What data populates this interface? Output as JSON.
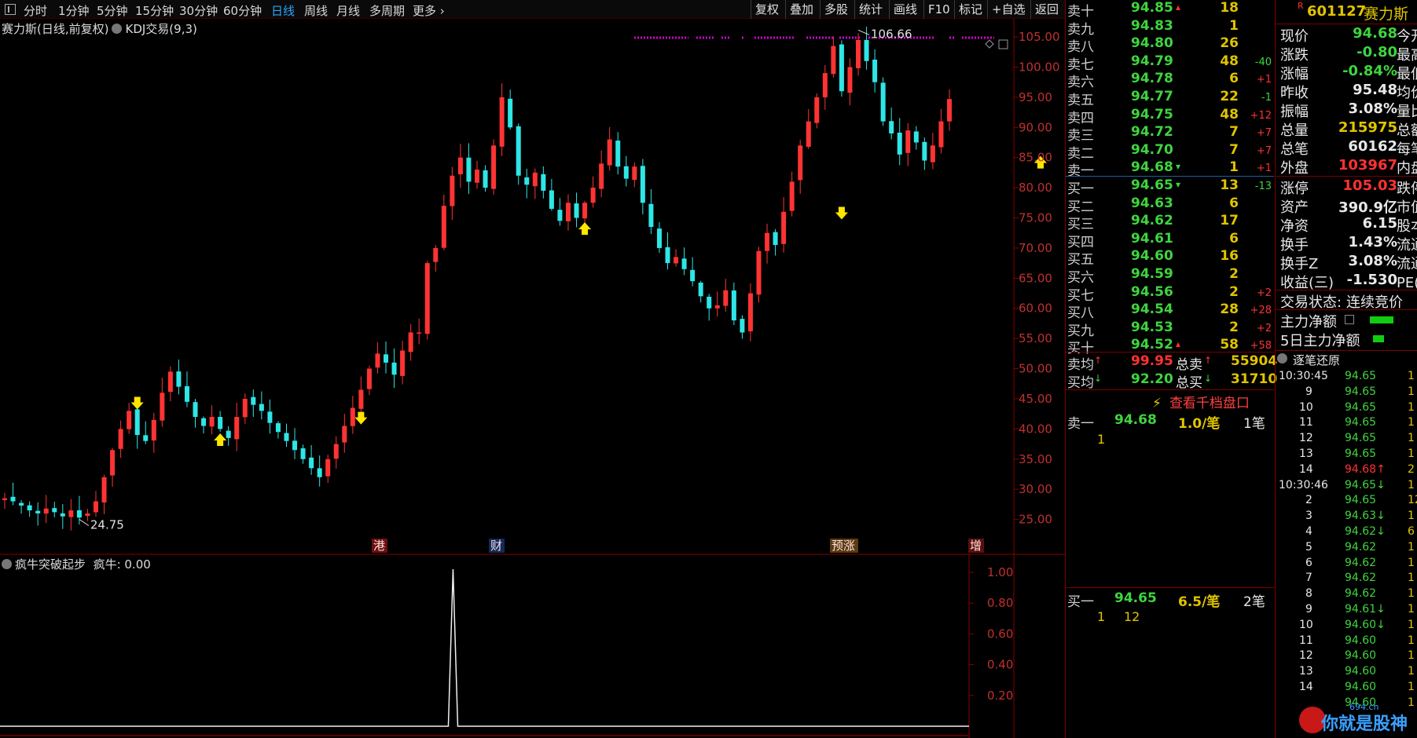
{
  "toolbar": {
    "periods": [
      "分时",
      "1分钟",
      "5分钟",
      "15分钟",
      "30分钟",
      "60分钟",
      "日线",
      "周线",
      "月线",
      "多周期",
      "更多"
    ],
    "active_period": "日线",
    "right_buttons": [
      "复权",
      "叠加",
      "多股",
      "统计",
      "画线",
      "F10",
      "标记",
      "+自选",
      "返回"
    ]
  },
  "chart": {
    "title": "赛力斯(日线,前复权)",
    "indicator": "KDJ交易(9,3)",
    "high_label": "106.66",
    "low_label": "24.75",
    "event_labels": [
      "港",
      "财",
      "预涨",
      "增"
    ],
    "colors": {
      "up": "#ff3333",
      "down": "#2ee6e6",
      "signal": "#ffe600",
      "magenta": "#d400d4"
    },
    "chart_data": {
      "type": "candlestick",
      "ylim": [
        20,
        108
      ],
      "yticks": [
        "105.00",
        "100.00",
        "95.00",
        "90.00",
        "85.00",
        "80.00",
        "75.00",
        "70.00",
        "65.00",
        "60.00",
        "55.00",
        "50.00",
        "45.00",
        "40.00",
        "35.00",
        "30.00",
        "25.00"
      ],
      "close_path": [
        28.5,
        28,
        27.3,
        26.5,
        26,
        26.8,
        26.2,
        25.5,
        26.5,
        25.3,
        26,
        28,
        32,
        36.5,
        40,
        43,
        39,
        38,
        41.5,
        46,
        49.5,
        47,
        44.5,
        42,
        40.5,
        42,
        40,
        38.5,
        42,
        45,
        44,
        43,
        41,
        39.5,
        38,
        36.5,
        35,
        33.5,
        32,
        35,
        37.5,
        40.5,
        43.5,
        46.5,
        50,
        52.5,
        51,
        49,
        53,
        56,
        56,
        67.5,
        70,
        77,
        82,
        85,
        81,
        83,
        80,
        87,
        95,
        90,
        82,
        80.5,
        82.5,
        79.5,
        76.5,
        74.5,
        77.5,
        75,
        77.5,
        80,
        84,
        88,
        83.5,
        81.5,
        83.5,
        77.5,
        73.5,
        70,
        67.5,
        68.5,
        66.5,
        64.5,
        62,
        60,
        60.5,
        63,
        58,
        56,
        62.5,
        69.5,
        72.5,
        70.5,
        76,
        81,
        87,
        91,
        95,
        99,
        103.5,
        96,
        100,
        104.5,
        101,
        97.5,
        91,
        89,
        85.5,
        89.5,
        87.5,
        84.5,
        87,
        91,
        94.7
      ],
      "signals": [
        {
          "idx": 16,
          "dir": "down",
          "price": 43.5
        },
        {
          "idx": 26,
          "dir": "up",
          "price": 39
        },
        {
          "idx": 43,
          "dir": "down",
          "price": 41
        },
        {
          "idx": 70,
          "dir": "up",
          "price": 74
        },
        {
          "idx": 101,
          "dir": "down",
          "price": 75
        },
        {
          "idx": 125,
          "dir": "up",
          "price": 85
        }
      ]
    }
  },
  "indicator_panel": {
    "title": "疯牛突破起步",
    "value_label": "疯牛: 0.00",
    "yticks": [
      "1.00",
      "0.80",
      "0.60",
      "0.40",
      "0.20"
    ],
    "spike_at": 56
  },
  "orderbook": {
    "asks": [
      {
        "label": "卖十",
        "price": "94.85",
        "vol": "18",
        "chg": "",
        "mark": "up"
      },
      {
        "label": "卖九",
        "price": "94.83",
        "vol": "1",
        "chg": ""
      },
      {
        "label": "卖八",
        "price": "94.80",
        "vol": "26",
        "chg": ""
      },
      {
        "label": "卖七",
        "price": "94.79",
        "vol": "48",
        "chg": "-40"
      },
      {
        "label": "卖六",
        "price": "94.78",
        "vol": "6",
        "chg": "+1"
      },
      {
        "label": "卖五",
        "price": "94.77",
        "vol": "22",
        "chg": "-1"
      },
      {
        "label": "卖四",
        "price": "94.75",
        "vol": "48",
        "chg": "+12"
      },
      {
        "label": "卖三",
        "price": "94.72",
        "vol": "7",
        "chg": "+7"
      },
      {
        "label": "卖二",
        "price": "94.70",
        "vol": "7",
        "chg": "+7"
      },
      {
        "label": "卖一",
        "price": "94.68",
        "vol": "1",
        "chg": "+1",
        "mark": "down"
      }
    ],
    "bids": [
      {
        "label": "买一",
        "price": "94.65",
        "vol": "13",
        "chg": "-13",
        "mark": "down"
      },
      {
        "label": "买二",
        "price": "94.63",
        "vol": "6",
        "chg": ""
      },
      {
        "label": "买三",
        "price": "94.62",
        "vol": "17",
        "chg": ""
      },
      {
        "label": "买四",
        "price": "94.61",
        "vol": "6",
        "chg": ""
      },
      {
        "label": "买五",
        "price": "94.60",
        "vol": "16",
        "chg": ""
      },
      {
        "label": "买六",
        "price": "94.59",
        "vol": "2",
        "chg": ""
      },
      {
        "label": "买七",
        "price": "94.56",
        "vol": "2",
        "chg": "+2"
      },
      {
        "label": "买八",
        "price": "94.54",
        "vol": "28",
        "chg": "+28"
      },
      {
        "label": "买九",
        "price": "94.53",
        "vol": "2",
        "chg": "+2"
      },
      {
        "label": "买十",
        "price": "94.52",
        "vol": "58",
        "chg": "+58",
        "mark": "up"
      }
    ],
    "ask_avg_label": "卖均",
    "ask_avg": "99.95",
    "total_sell_label": "总卖",
    "total_sell": "55904",
    "bid_avg_label": "买均",
    "bid_avg": "92.20",
    "total_buy_label": "总买",
    "total_buy": "31710",
    "thousand_link": "查看千档盘口",
    "ask1": {
      "label": "卖一",
      "price": "94.68",
      "per": "1.0/笔",
      "count": "1笔",
      "detail": "1"
    },
    "bid1": {
      "label": "买一",
      "price": "94.65",
      "per": "6.5/笔",
      "count": "2笔",
      "detail1": "1",
      "detail2": "12"
    }
  },
  "quote": {
    "r_badge": "R",
    "code": "601127",
    "name": "赛力斯",
    "rows": [
      {
        "label": "现价",
        "value": "94.68",
        "cls": "dn",
        "label2": "今开"
      },
      {
        "label": "涨跌",
        "value": "-0.80",
        "cls": "dn",
        "label2": "最高"
      },
      {
        "label": "涨幅",
        "value": "-0.84%",
        "cls": "dn",
        "label2": "最低"
      },
      {
        "label": "昨收",
        "value": "95.48",
        "cls": "wht",
        "label2": "均价"
      },
      {
        "label": "振幅",
        "value": "3.08%",
        "cls": "wht",
        "label2": "量比"
      },
      {
        "label": "总量",
        "value": "215975",
        "cls": "yel",
        "label2": "总额"
      },
      {
        "label": "总笔",
        "value": "60162",
        "cls": "wht",
        "label2": "每笔"
      },
      {
        "label": "外盘",
        "value": "103967",
        "cls": "up",
        "label2": "内盘"
      }
    ],
    "rows2": [
      {
        "label": "涨停",
        "value": "105.03",
        "cls": "up",
        "label2": "跌停"
      },
      {
        "label": "资产",
        "value": "390.9亿",
        "cls": "wht",
        "label2": "市值"
      },
      {
        "label": "净资",
        "value": "6.15",
        "cls": "wht",
        "label2": "股本"
      },
      {
        "label": "换手",
        "value": "1.43%",
        "cls": "wht",
        "label2": "流通"
      },
      {
        "label": "换手Z",
        "value": "3.08%",
        "cls": "wht",
        "label2": "流通"
      },
      {
        "label": "收益(三)",
        "value": "-1.530",
        "cls": "wht",
        "label2": "PE(动)"
      }
    ],
    "status_label": "交易状态:",
    "status": "连续竞价",
    "main_net_label": "主力净额",
    "main_net5_label": "5日主力净额",
    "ticks_title": "逐笔还原",
    "ticks": [
      {
        "t": "10:30:45",
        "p": "94.65",
        "v": "1",
        "cls": "dn"
      },
      {
        "t": "9",
        "p": "94.65",
        "v": "1",
        "cls": "dn"
      },
      {
        "t": "10",
        "p": "94.65",
        "v": "1",
        "cls": "dn"
      },
      {
        "t": "11",
        "p": "94.65",
        "v": "1",
        "cls": "dn"
      },
      {
        "t": "12",
        "p": "94.65",
        "v": "1",
        "cls": "dn"
      },
      {
        "t": "13",
        "p": "94.65",
        "v": "1",
        "cls": "dn"
      },
      {
        "t": "14",
        "p": "94.68↑",
        "v": "2",
        "cls": "up"
      },
      {
        "t": "10:30:46",
        "p": "94.65↓",
        "v": "1",
        "cls": "dn"
      },
      {
        "t": "2",
        "p": "94.65",
        "v": "12",
        "cls": "dn"
      },
      {
        "t": "3",
        "p": "94.63↓",
        "v": "1",
        "cls": "dn"
      },
      {
        "t": "4",
        "p": "94.62↓",
        "v": "6",
        "cls": "dn"
      },
      {
        "t": "5",
        "p": "94.62",
        "v": "1",
        "cls": "dn"
      },
      {
        "t": "6",
        "p": "94.62",
        "v": "1",
        "cls": "dn"
      },
      {
        "t": "7",
        "p": "94.62",
        "v": "1",
        "cls": "dn"
      },
      {
        "t": "8",
        "p": "94.62",
        "v": "1",
        "cls": "dn"
      },
      {
        "t": "9",
        "p": "94.61↓",
        "v": "1",
        "cls": "dn"
      },
      {
        "t": "10",
        "p": "94.60↓",
        "v": "1",
        "cls": "dn"
      },
      {
        "t": "11",
        "p": "94.60",
        "v": "1",
        "cls": "dn"
      },
      {
        "t": "12",
        "p": "94.60",
        "v": "1",
        "cls": "dn"
      },
      {
        "t": "13",
        "p": "94.60",
        "v": "1",
        "cls": "dn"
      },
      {
        "t": "14",
        "p": "94.60",
        "v": "1",
        "cls": "dn"
      },
      {
        "t": "",
        "p": "94.60",
        "v": "1",
        "cls": "dn"
      }
    ],
    "watermark": "你就是股神",
    "watermark_small": "694.cn"
  }
}
